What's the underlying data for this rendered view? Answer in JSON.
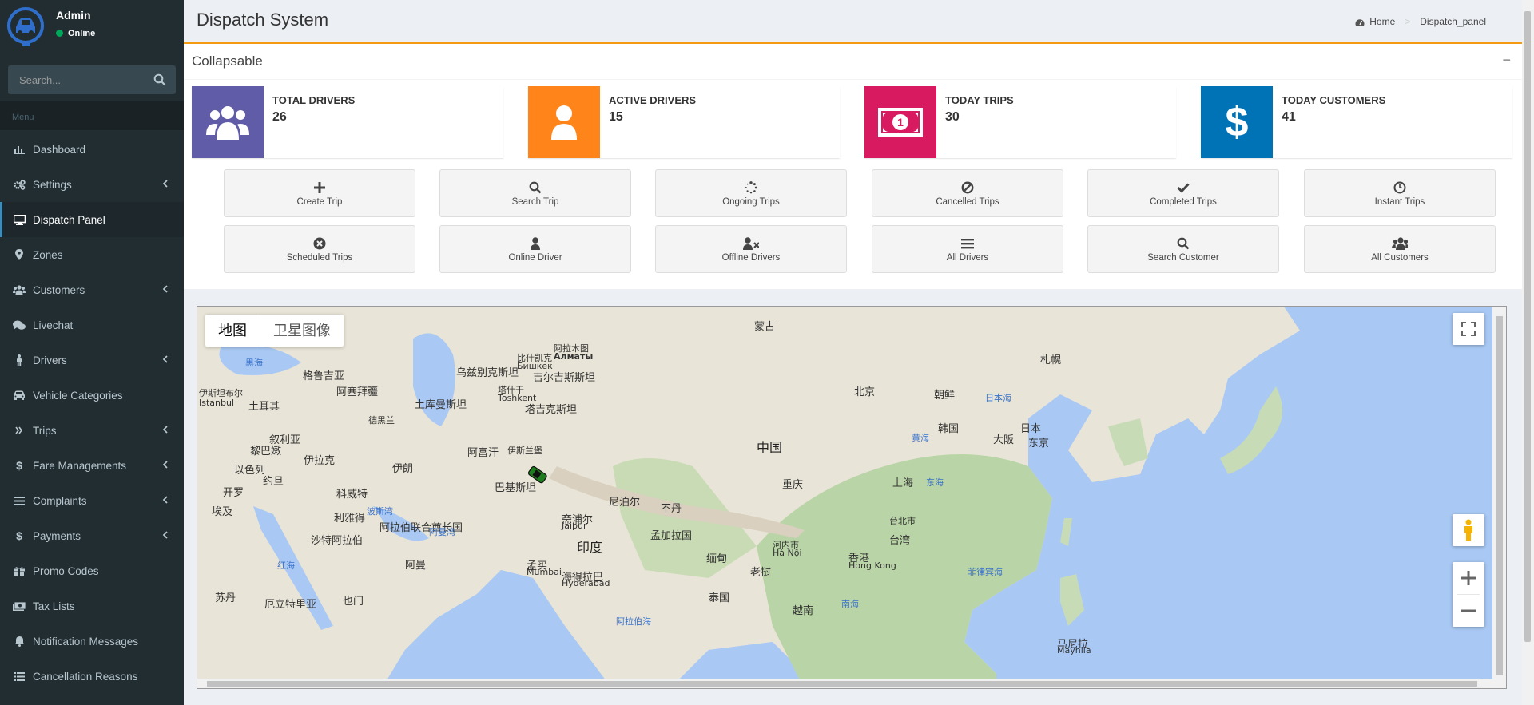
{
  "user": {
    "name": "Admin",
    "status": "Online"
  },
  "search": {
    "placeholder": "Search..."
  },
  "menu_header": "Menu",
  "menu": [
    {
      "label": "Dashboard",
      "icon": "bar-chart-icon",
      "has_children": false,
      "active": false
    },
    {
      "label": "Settings",
      "icon": "gears-icon",
      "has_children": true,
      "active": false
    },
    {
      "label": "Dispatch Panel",
      "icon": "desktop-icon",
      "has_children": false,
      "active": true
    },
    {
      "label": "Zones",
      "icon": "map-marker-icon",
      "has_children": false,
      "active": false
    },
    {
      "label": "Customers",
      "icon": "users-icon",
      "has_children": true,
      "active": false
    },
    {
      "label": "Livechat",
      "icon": "comments-icon",
      "has_children": false,
      "active": false
    },
    {
      "label": "Drivers",
      "icon": "male-icon",
      "has_children": true,
      "active": false
    },
    {
      "label": "Vehicle Categories",
      "icon": "car-icon",
      "has_children": false,
      "active": false
    },
    {
      "label": "Trips",
      "icon": "double-angle-icon",
      "has_children": true,
      "active": false
    },
    {
      "label": "Fare Managements",
      "icon": "dollar-icon",
      "has_children": true,
      "active": false
    },
    {
      "label": "Complaints",
      "icon": "list-icon",
      "has_children": true,
      "active": false
    },
    {
      "label": "Payments",
      "icon": "dollar-icon",
      "has_children": true,
      "active": false
    },
    {
      "label": "Promo Codes",
      "icon": "gift-icon",
      "has_children": false,
      "active": false
    },
    {
      "label": "Tax Lists",
      "icon": "money-icon",
      "has_children": false,
      "active": false
    },
    {
      "label": "Notification Messages",
      "icon": "bell-icon",
      "has_children": false,
      "active": false
    },
    {
      "label": "Cancellation Reasons",
      "icon": "list-icon",
      "has_children": false,
      "active": false
    }
  ],
  "header": {
    "title": "Dispatch System",
    "breadcrumb_home": "Home",
    "breadcrumb_current": "Dispatch_panel"
  },
  "box": {
    "title": "Collapsable",
    "collapse": "−"
  },
  "stats": [
    {
      "label": "TOTAL DRIVERS",
      "value": "26",
      "color": "#605ca8",
      "icon": "users-icon"
    },
    {
      "label": "ACTIVE DRIVERS",
      "value": "15",
      "color": "#ff851b",
      "icon": "user-icon"
    },
    {
      "label": "TODAY TRIPS",
      "value": "30",
      "color": "#d81b60",
      "icon": "money-icon"
    },
    {
      "label": "TODAY CUSTOMERS",
      "value": "41",
      "color": "#0073b7",
      "icon": "dollar-icon"
    }
  ],
  "actions": [
    {
      "label": "Create Trip",
      "icon": "plus-icon"
    },
    {
      "label": "Search Trip",
      "icon": "search-icon"
    },
    {
      "label": "Ongoing Trips",
      "icon": "spinner-icon"
    },
    {
      "label": "Cancelled Trips",
      "icon": "ban-icon"
    },
    {
      "label": "Completed Trips",
      "icon": "check-icon"
    },
    {
      "label": "Instant Trips",
      "icon": "clock-icon"
    },
    {
      "label": "Scheduled Trips",
      "icon": "times-circle-icon"
    },
    {
      "label": "Online Driver",
      "icon": "user-icon"
    },
    {
      "label": "Offline Drivers",
      "icon": "user-times-icon"
    },
    {
      "label": "All Drivers",
      "icon": "bars-icon"
    },
    {
      "label": "Search Customer",
      "icon": "search-icon"
    },
    {
      "label": "All Customers",
      "icon": "users-icon"
    }
  ],
  "map": {
    "type_map": "地图",
    "type_satellite": "卫星图像",
    "labels": [
      {
        "text": "中国",
        "cls": "big"
      },
      {
        "text": "印度",
        "cls": "big"
      },
      {
        "text": "蒙古",
        "cls": ""
      },
      {
        "text": "朝鲜",
        "cls": ""
      },
      {
        "text": "韩国",
        "cls": ""
      },
      {
        "text": "日本",
        "cls": ""
      },
      {
        "text": "东京",
        "cls": ""
      },
      {
        "text": "大阪",
        "cls": ""
      },
      {
        "text": "札幌",
        "cls": ""
      },
      {
        "text": "北京",
        "cls": ""
      },
      {
        "text": "上海",
        "cls": ""
      },
      {
        "text": "重庆",
        "cls": ""
      },
      {
        "text": "香港",
        "cls": ""
      },
      {
        "text": "Hong Kong",
        "cls": ""
      },
      {
        "text": "台湾",
        "cls": ""
      },
      {
        "text": "台北市",
        "cls": ""
      },
      {
        "text": "缅甸",
        "cls": ""
      },
      {
        "text": "老挝",
        "cls": ""
      },
      {
        "text": "泰国",
        "cls": ""
      },
      {
        "text": "越南",
        "cls": ""
      },
      {
        "text": "河内市",
        "cls": ""
      },
      {
        "text": "Hà Nội",
        "cls": ""
      },
      {
        "text": "孟加拉国",
        "cls": ""
      },
      {
        "text": "尼泊尔",
        "cls": ""
      },
      {
        "text": "不丹",
        "cls": ""
      },
      {
        "text": "巴基斯坦",
        "cls": ""
      },
      {
        "text": "阿富汗",
        "cls": ""
      },
      {
        "text": "伊斯兰堡",
        "cls": ""
      },
      {
        "text": "伊朗",
        "cls": ""
      },
      {
        "text": "伊拉克",
        "cls": ""
      },
      {
        "text": "叙利亚",
        "cls": ""
      },
      {
        "text": "约旦",
        "cls": ""
      },
      {
        "text": "以色列",
        "cls": ""
      },
      {
        "text": "黎巴嫩",
        "cls": ""
      },
      {
        "text": "科威特",
        "cls": ""
      },
      {
        "text": "沙特阿拉伯",
        "cls": ""
      },
      {
        "text": "利雅得",
        "cls": ""
      },
      {
        "text": "阿拉伯联合酋长国",
        "cls": ""
      },
      {
        "text": "阿曼",
        "cls": ""
      },
      {
        "text": "也门",
        "cls": ""
      },
      {
        "text": "苏丹",
        "cls": ""
      },
      {
        "text": "埃及",
        "cls": ""
      },
      {
        "text": "开罗",
        "cls": ""
      },
      {
        "text": "厄立特里亚",
        "cls": ""
      },
      {
        "text": "土耳其",
        "cls": ""
      },
      {
        "text": "格鲁吉亚",
        "cls": ""
      },
      {
        "text": "阿塞拜疆",
        "cls": ""
      },
      {
        "text": "土库曼斯坦",
        "cls": ""
      },
      {
        "text": "乌兹别克斯坦",
        "cls": ""
      },
      {
        "text": "吉尔吉斯斯坦",
        "cls": ""
      },
      {
        "text": "塔吉克斯坦",
        "cls": ""
      },
      {
        "text": "德黑兰",
        "cls": ""
      },
      {
        "text": "阿拉木图",
        "cls": ""
      },
      {
        "text": "Алматы",
        "cls": ""
      },
      {
        "text": "比什凯克",
        "cls": ""
      },
      {
        "text": "Бишкек",
        "cls": ""
      },
      {
        "text": "塔什干",
        "cls": ""
      },
      {
        "text": "Toshkent",
        "cls": ""
      },
      {
        "text": "Istanbul",
        "cls": ""
      },
      {
        "text": "伊斯坦布尔",
        "cls": ""
      },
      {
        "text": "孟买",
        "cls": ""
      },
      {
        "text": "Mumbai",
        "cls": ""
      },
      {
        "text": "斋浦尔",
        "cls": ""
      },
      {
        "text": "Jaipur",
        "cls": ""
      },
      {
        "text": "海得拉巴",
        "cls": ""
      },
      {
        "text": "Hyderabad",
        "cls": ""
      },
      {
        "text": "马尼拉",
        "cls": ""
      },
      {
        "text": "Maynila",
        "cls": ""
      },
      {
        "text": "黑海",
        "cls": "sea"
      },
      {
        "text": "日本海",
        "cls": "sea"
      },
      {
        "text": "黄海",
        "cls": "sea"
      },
      {
        "text": "东海",
        "cls": "sea"
      },
      {
        "text": "南海",
        "cls": "sea"
      },
      {
        "text": "菲律宾海",
        "cls": "sea"
      },
      {
        "text": "阿拉伯海",
        "cls": "sea"
      },
      {
        "text": "波斯湾",
        "cls": "sea"
      },
      {
        "text": "阿曼湾",
        "cls": "sea"
      },
      {
        "text": "红海",
        "cls": "sea"
      }
    ]
  }
}
